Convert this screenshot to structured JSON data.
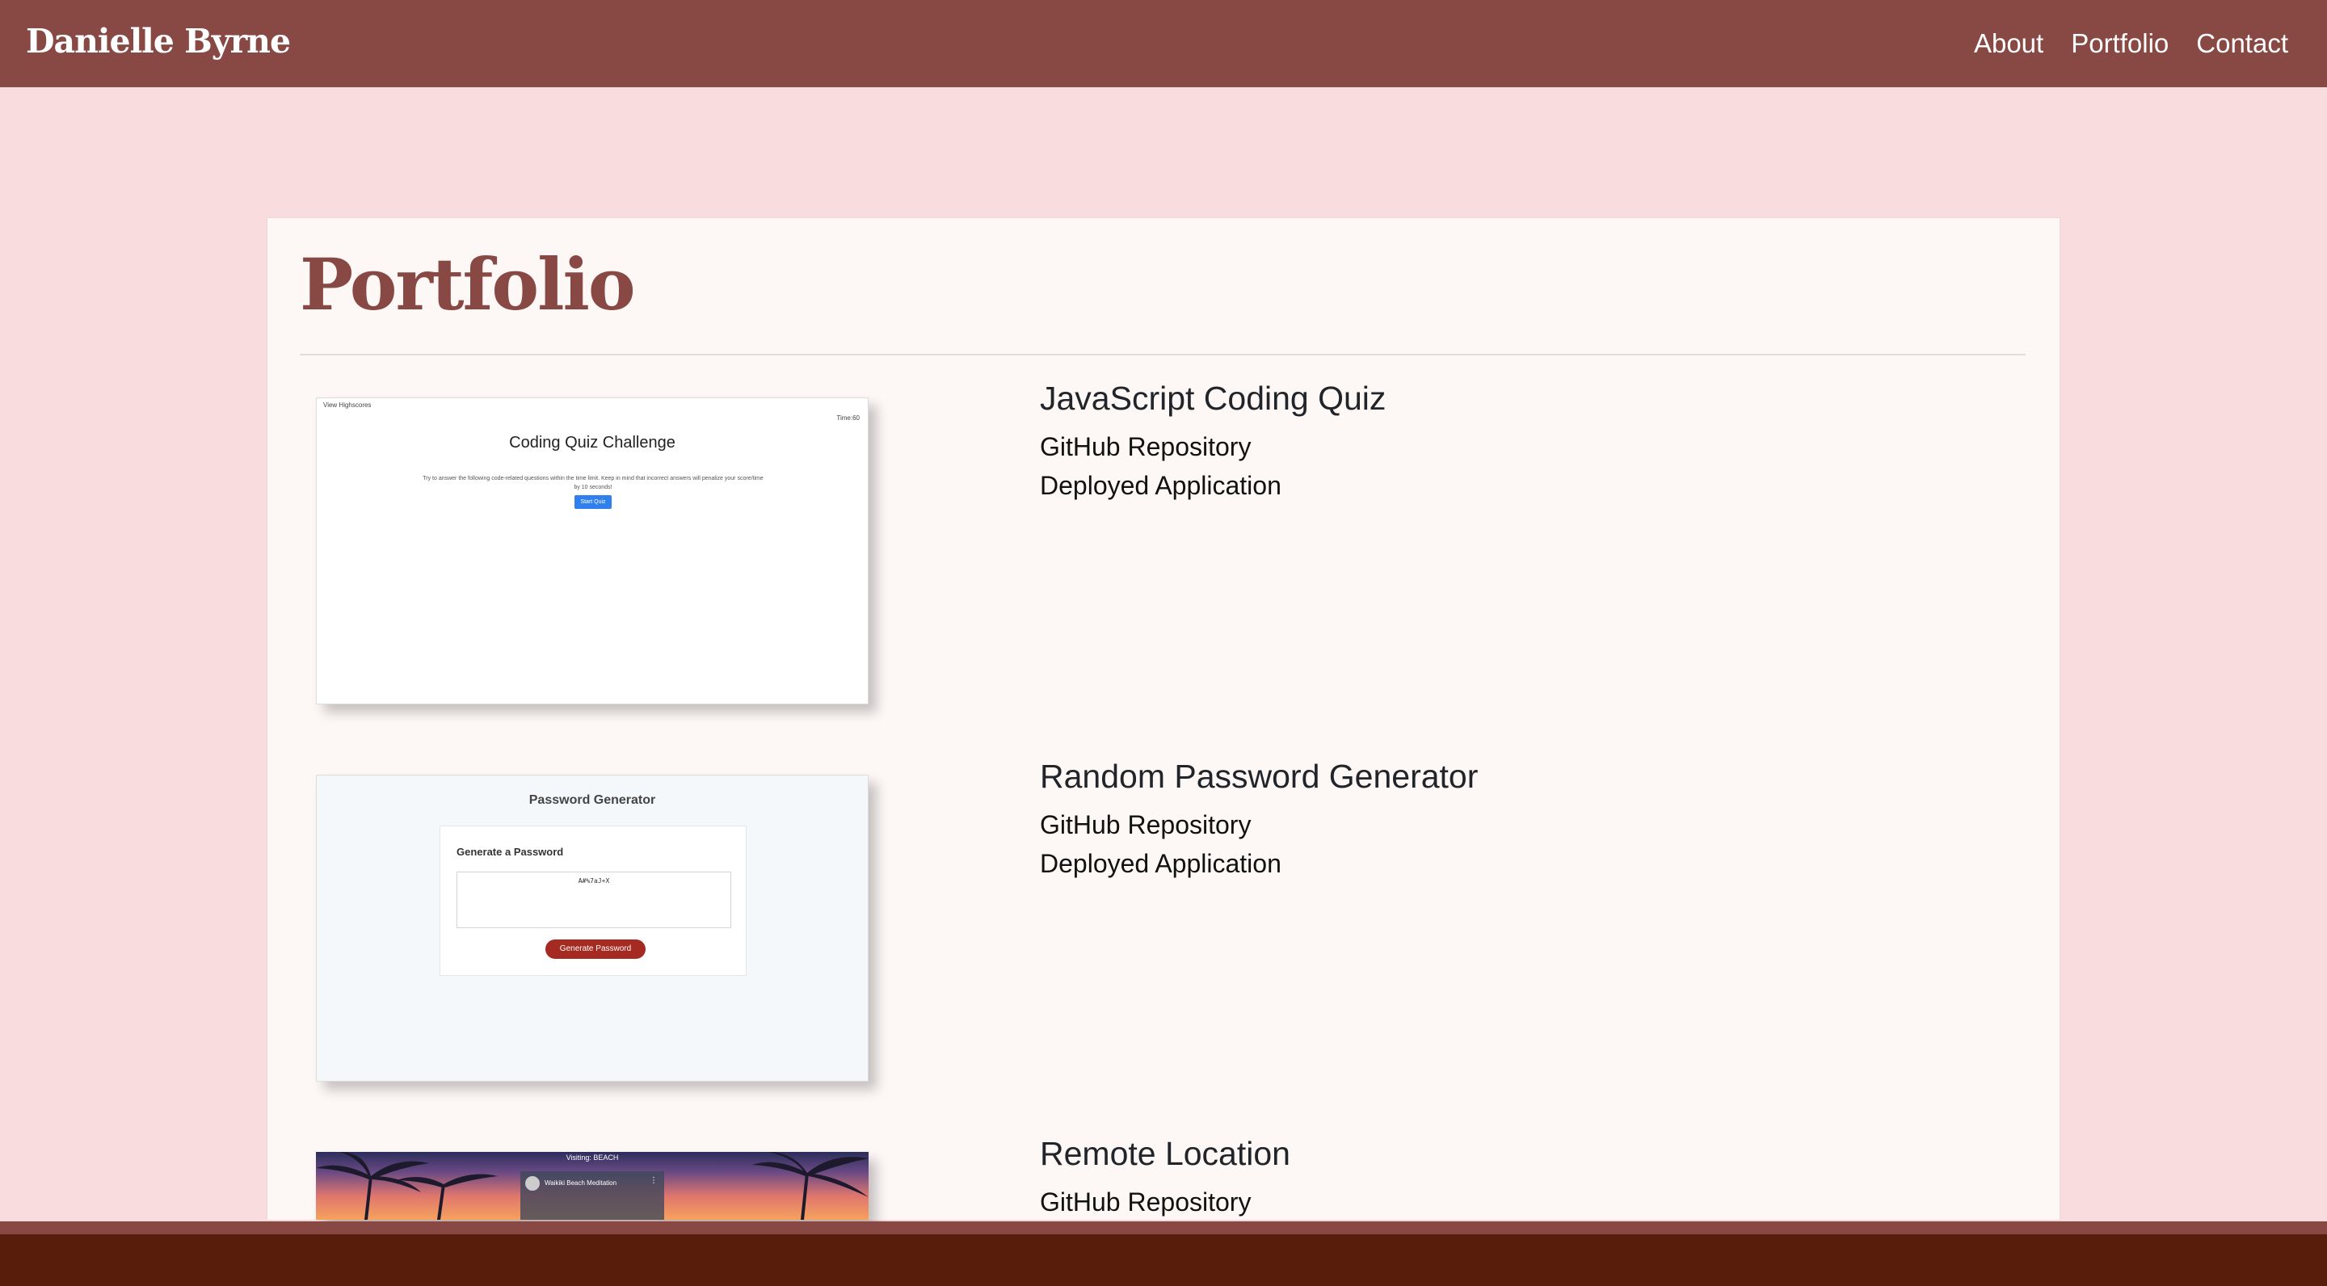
{
  "navbar": {
    "brand": "Danielle Byrne",
    "links": [
      "About",
      "Portfolio",
      "Contact"
    ]
  },
  "page": {
    "title": "Portfolio"
  },
  "projects": [
    {
      "title": "JavaScript Coding Quiz",
      "github_label": "GitHub Repository",
      "deployed_label": "Deployed Application",
      "thumb": {
        "top_link": "View Highscores",
        "time": "Time:60",
        "heading": "Coding Quiz Challenge",
        "text": "Try to answer the following code-related questions within the time limit. Keep in mind that incorrect answers will penalize your score/time by 10 seconds!",
        "button": "Start Quiz"
      }
    },
    {
      "title": "Random Password Generator",
      "github_label": "GitHub Repository",
      "deployed_label": "Deployed Application",
      "thumb": {
        "heading": "Password Generator",
        "subheading": "Generate a Password",
        "password": "A#%7aJ+X",
        "button": "Generate Password"
      }
    },
    {
      "title": "Remote Location",
      "github_label": "GitHub Repository",
      "thumb": {
        "caption": "Visiting: BEACH",
        "video_title": "Waikiki Beach Meditation"
      }
    }
  ],
  "colors": {
    "navbar": "#884944",
    "background": "#f9dcdd",
    "card": "#fdf7f6",
    "title": "#884944",
    "footer": "#581d0b"
  }
}
